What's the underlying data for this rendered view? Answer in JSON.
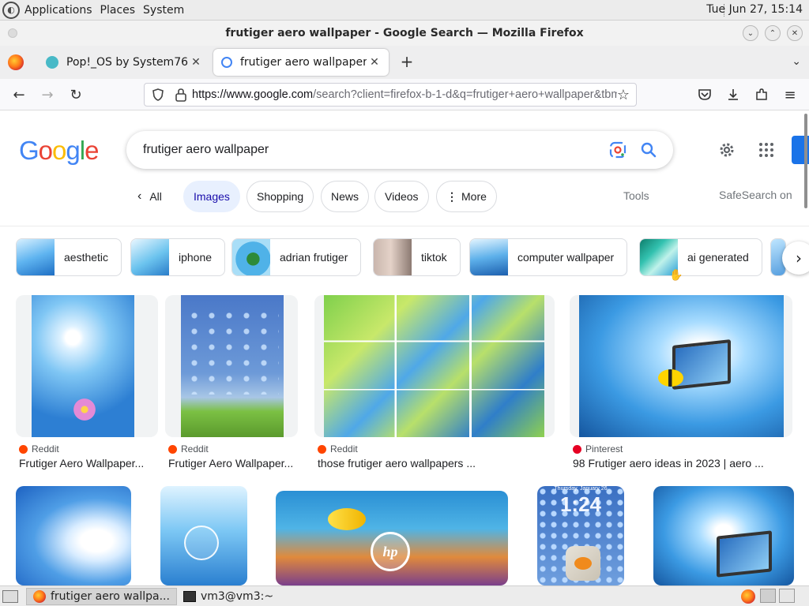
{
  "os_panel": {
    "menus": [
      "Applications",
      "Places",
      "System"
    ],
    "clock": "Tue Jun 27, 15:14"
  },
  "window": {
    "title": "frutiger aero wallpaper - Google Search — Mozilla Firefox"
  },
  "tabs": [
    {
      "label": "Pop!_OS by System76",
      "active": false
    },
    {
      "label": "frutiger aero wallpaper - Google Search",
      "active": true
    }
  ],
  "address_bar": {
    "url_host": "https://www.google.com",
    "url_rest": "/search?client=firefox-b-1-d&q=frutiger+aero+wallpaper&tbm=isch"
  },
  "google": {
    "logo_letters": [
      "G",
      "o",
      "o",
      "g",
      "l",
      "e"
    ],
    "logo_colors": [
      "#4285F4",
      "#EA4335",
      "#FBBC05",
      "#4285F4",
      "#34A853",
      "#EA4335"
    ],
    "query": "frutiger aero wallpaper",
    "nav": {
      "all": "All",
      "tabs": [
        "Images",
        "Shopping",
        "News",
        "Videos",
        "More"
      ],
      "selected": "Images",
      "tools": "Tools",
      "safesearch": "SafeSearch on"
    }
  },
  "refinements": [
    "aesthetic",
    "iphone",
    "adrian frutiger",
    "tiktok",
    "computer wallpaper",
    "ai generated"
  ],
  "results_row1": [
    {
      "source": "Reddit",
      "source_color": "#ff4500",
      "title": "Frutiger Aero Wallpaper..."
    },
    {
      "source": "Reddit",
      "source_color": "#ff4500",
      "title": "Frutiger Aero Wallpaper..."
    },
    {
      "source": "Reddit",
      "source_color": "#ff4500",
      "title": "those frutiger aero wallpapers ..."
    },
    {
      "source": "Pinterest",
      "source_color": "#e60023",
      "title": "98 Frutiger aero ideas in 2023 | aero ..."
    }
  ],
  "results_row2_text": {
    "phone_time": "1:24",
    "phone_date": "Thursday, January 26",
    "hp_logo": "hp"
  },
  "taskbar": {
    "items": [
      "frutiger aero wallpa...",
      "vm3@vm3:~"
    ]
  }
}
